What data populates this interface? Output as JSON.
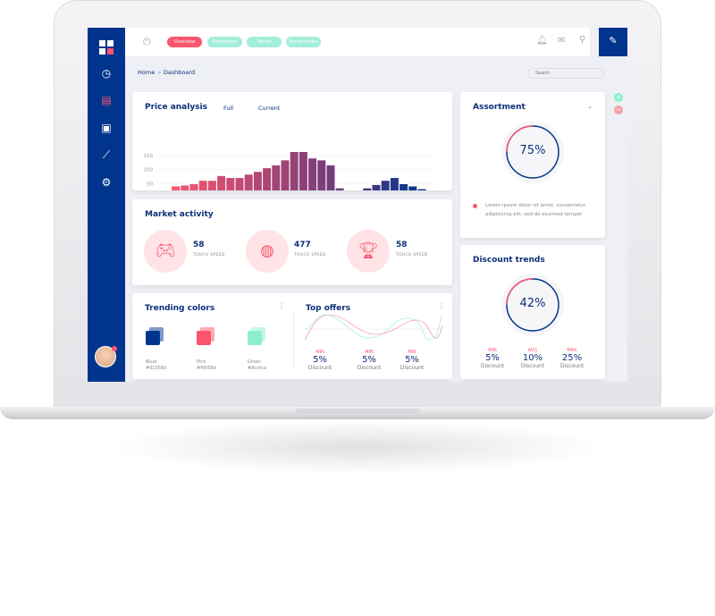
{
  "topbar": {
    "tabs": [
      {
        "label": "Overview",
        "color": "#f9556d"
      },
      {
        "label": "Promotions",
        "color": "#a3eedb"
      },
      {
        "label": "Trends",
        "color": "#a3eedb"
      },
      {
        "label": "Promo codes",
        "color": "#a3eedb"
      }
    ]
  },
  "breadcrumb": {
    "home": "Home",
    "sep": ">",
    "current": "Dashboard"
  },
  "search": {
    "placeholder": "Search"
  },
  "price_analysis": {
    "title": "Price analysis",
    "toggle_full": "Full",
    "toggle_current": "Current"
  },
  "chart_data": {
    "type": "bar",
    "x": [
      70,
      85,
      100,
      115,
      130,
      145,
      160,
      175,
      190,
      205,
      220,
      235,
      250,
      265,
      280,
      295,
      310,
      325,
      340,
      355,
      370,
      385,
      400,
      415,
      430,
      445,
      460,
      475
    ],
    "values": [
      40,
      43,
      48,
      60,
      60,
      77,
      70,
      70,
      82,
      92,
      105,
      115,
      133,
      163,
      163,
      140,
      133,
      115,
      33,
      20,
      5,
      33,
      45,
      60,
      70,
      48,
      40,
      30
    ],
    "xticks": [
      "50",
      "100",
      "150",
      "200",
      "250",
      "300",
      "350",
      "400",
      "450"
    ],
    "yticks": [
      "0",
      "50",
      "100",
      "150"
    ],
    "xlim": [
      50,
      500
    ],
    "ylim": [
      0,
      170
    ],
    "grid": true
  },
  "market": {
    "title": "Market activity",
    "items": [
      {
        "value": "58",
        "label": "TOUCH SPEED",
        "icon": "gamepad-icon"
      },
      {
        "value": "477",
        "label": "TOUCH SPEED",
        "icon": "basketball-icon"
      },
      {
        "value": "58",
        "label": "TOUCH SPEED",
        "icon": "trophy-icon"
      }
    ]
  },
  "trending": {
    "title": "Trending colors",
    "colors": [
      {
        "name": "BLue",
        "hex": "#01358d"
      },
      {
        "name": "Pink",
        "hex": "#f9556d"
      },
      {
        "name": "Green",
        "hex": "#8cefca"
      }
    ]
  },
  "offers": {
    "title": "Top offers",
    "stats": [
      {
        "label": "MIN",
        "value": "5%",
        "desc": "Discount"
      },
      {
        "label": "MIN",
        "value": "5%",
        "desc": "Discount"
      },
      {
        "label": "MIN",
        "value": "5%",
        "desc": "Discount"
      }
    ]
  },
  "assortment": {
    "title": "Assortment",
    "value": "75%",
    "percent": 75,
    "text": "Lorem ipsum dolor sit amet, consectetur adipisicing elit, sed do eiusmod tempor"
  },
  "discount": {
    "title": "Discount trends",
    "value": "42%",
    "percent": 42,
    "stats": [
      {
        "label": "MIN",
        "value": "5%",
        "desc": "Discount"
      },
      {
        "label": "AVG",
        "value": "10%",
        "desc": "Discount"
      },
      {
        "label": "MAX",
        "value": "25%",
        "desc": "Discount"
      }
    ]
  }
}
